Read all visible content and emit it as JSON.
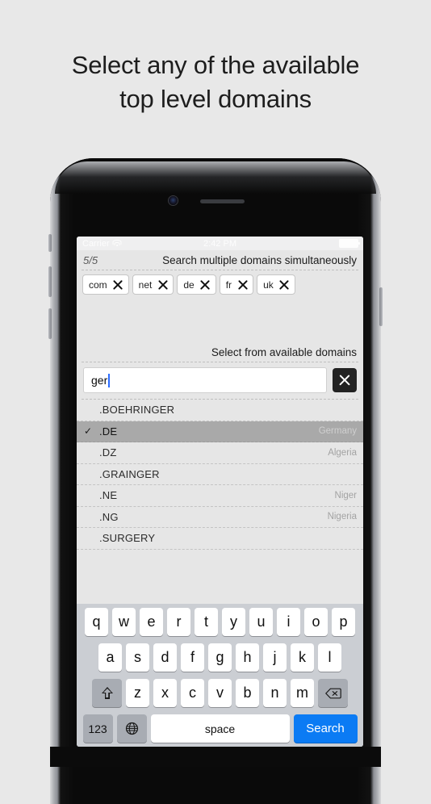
{
  "headline": {
    "line1": "Select any of the available",
    "line2": "top level domains"
  },
  "statusbar": {
    "carrier": "Carrier",
    "wifi_icon": "wifi-icon",
    "time": "2:42 PM",
    "battery_icon": "battery-icon"
  },
  "header": {
    "counter": "5/5",
    "title": "Search multiple domains simultaneously"
  },
  "tokens": [
    {
      "label": "com",
      "close_icon": "close-icon"
    },
    {
      "label": "net",
      "close_icon": "close-icon"
    },
    {
      "label": "de",
      "close_icon": "close-icon"
    },
    {
      "label": "fr",
      "close_icon": "close-icon"
    },
    {
      "label": "uk",
      "close_icon": "close-icon"
    }
  ],
  "select_label": "Select from available domains",
  "search": {
    "value": "ger",
    "placeholder": "",
    "clear_icon": "clear-icon"
  },
  "list": {
    "check_glyph": "✓",
    "rows": [
      {
        "label": ".BOEHRINGER",
        "detail": "",
        "selected": false
      },
      {
        "label": ".DE",
        "detail": "Germany",
        "selected": true
      },
      {
        "label": ".DZ",
        "detail": "Algeria",
        "selected": false
      },
      {
        "label": ".GRAINGER",
        "detail": "",
        "selected": false
      },
      {
        "label": ".NE",
        "detail": "Niger",
        "selected": false
      },
      {
        "label": ".NG",
        "detail": "Nigeria",
        "selected": false
      },
      {
        "label": ".SURGERY",
        "detail": "",
        "selected": false
      }
    ]
  },
  "keyboard": {
    "row1": [
      "q",
      "w",
      "e",
      "r",
      "t",
      "y",
      "u",
      "i",
      "o",
      "p"
    ],
    "row2": [
      "a",
      "s",
      "d",
      "f",
      "g",
      "h",
      "j",
      "k",
      "l"
    ],
    "row3": [
      "z",
      "x",
      "c",
      "v",
      "b",
      "n",
      "m"
    ],
    "shift_icon": "shift-icon",
    "delete_icon": "delete-icon",
    "numbers_label": "123",
    "globe_icon": "globe-icon",
    "space_label": "space",
    "search_label": "Search"
  },
  "colors": {
    "accent_blue": "#0b7bf4",
    "caret_blue": "#2b6cff",
    "screen_bg": "#e6e6e6",
    "keyboard_bg": "#cbced3",
    "selected_row": "#a9a9a9",
    "clear_button": "#222222"
  }
}
